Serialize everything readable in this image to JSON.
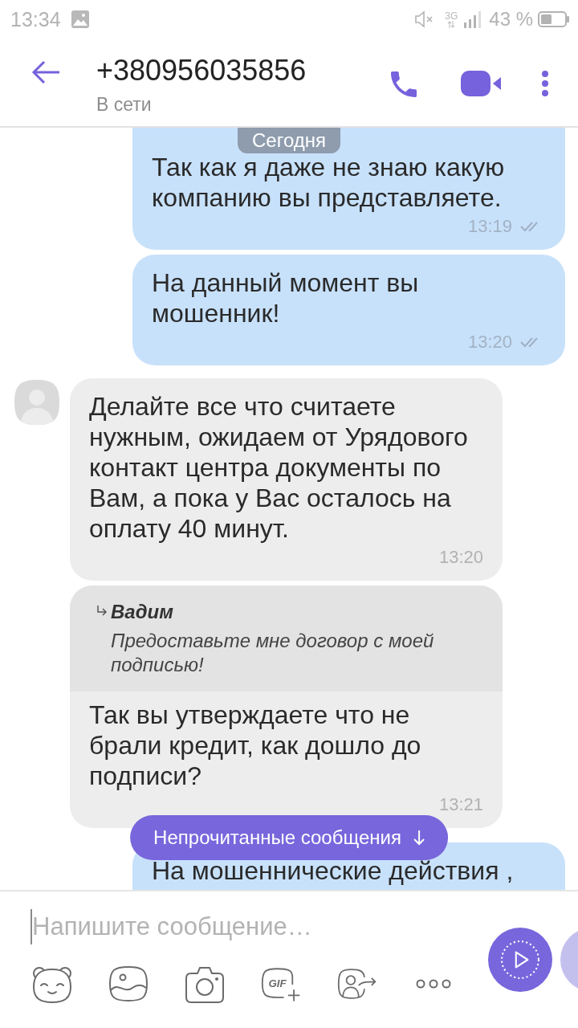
{
  "status_bar": {
    "time": "13:34",
    "network": "3G",
    "battery": "43 %"
  },
  "header": {
    "title": "+380956035856",
    "subtitle": "В сети"
  },
  "date_chip": "Сегодня",
  "messages": [
    {
      "kind": "outgoing",
      "text": "Так как я даже не знаю какую\nкомпанию вы представляете.",
      "time": "13:19",
      "delivered": true
    },
    {
      "kind": "outgoing",
      "text": "На данный момент вы\nмошенник!",
      "time": "13:20",
      "delivered": true
    },
    {
      "kind": "incoming",
      "avatar": true,
      "text": "Делайте все что считаете\nнужным, ожидаем от Урядового\nконтакт центра документы по\nВам, а пока у Вас осталось на\nоплату 40 минут.",
      "time": "13:20"
    },
    {
      "kind": "incoming",
      "avatar": false,
      "reply": {
        "author": "Вадим",
        "text": "Предоставьте мне договор с моей\nподписью!"
      },
      "text": "Так вы утверждаете что не\nбрали кредит, как дошло до\nподписи?",
      "time": "13:21"
    },
    {
      "kind": "outgoing",
      "text": "На мошеннические действия ,"
    }
  ],
  "unread_banner": "Непрочитанные сообщения",
  "composer": {
    "placeholder": "Напишите сообщение…",
    "gif_label": "GIF"
  }
}
